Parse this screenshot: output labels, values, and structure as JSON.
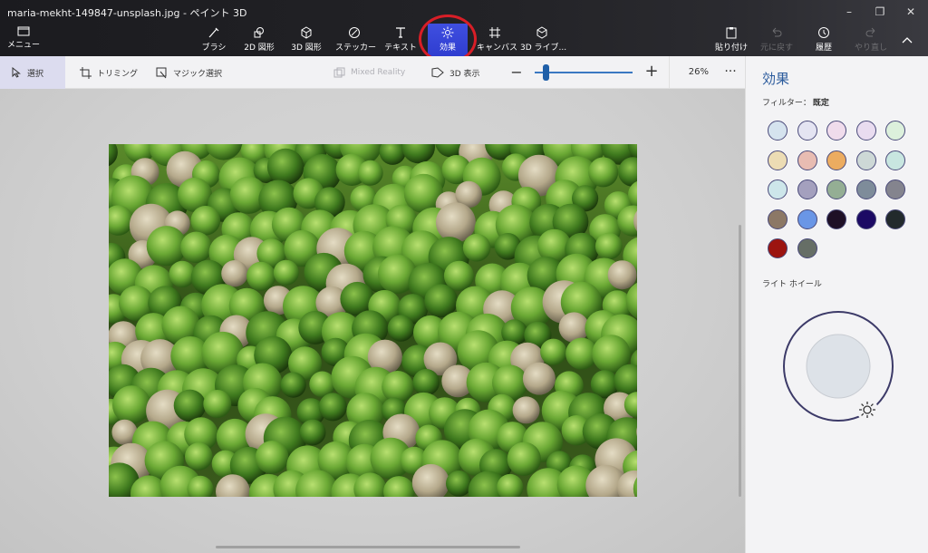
{
  "window": {
    "title": "maria-mekht-149847-unsplash.jpg - ペイント 3D",
    "controls": [
      "–",
      "❐",
      "✕"
    ]
  },
  "ribbon": {
    "menu_label": "メニュー",
    "tools": [
      {
        "id": "brush",
        "label": "ブラシ",
        "icon": "brush-icon"
      },
      {
        "id": "shapes2d",
        "label": "2D 図形",
        "icon": "shapes-2d-icon"
      },
      {
        "id": "shapes3d",
        "label": "3D 図形",
        "icon": "cube-icon"
      },
      {
        "id": "stickers",
        "label": "ステッカー",
        "icon": "sticker-icon"
      },
      {
        "id": "text",
        "label": "テキスト",
        "icon": "text-icon"
      },
      {
        "id": "effects",
        "label": "効果",
        "icon": "sun-icon",
        "active": true
      },
      {
        "id": "canvas",
        "label": "キャンバス",
        "icon": "canvas-icon"
      },
      {
        "id": "library3d",
        "label": "3D ライブ...",
        "icon": "library-3d-icon"
      }
    ],
    "right_tools": [
      {
        "id": "paste",
        "label": "貼り付け",
        "icon": "paste-icon",
        "enabled": true
      },
      {
        "id": "undo",
        "label": "元に戻す",
        "icon": "undo-icon",
        "enabled": false
      },
      {
        "id": "history",
        "label": "履歴",
        "icon": "history-icon",
        "enabled": true
      },
      {
        "id": "redo",
        "label": "やり直し",
        "icon": "redo-icon",
        "enabled": false
      }
    ],
    "collapse_icon": "chevron-up-icon"
  },
  "command_bar": {
    "select_label": "選択",
    "crop_label": "トリミング",
    "magic_select_label": "マジック選択",
    "mixed_reality_label": "Mixed Reality",
    "view3d_label": "3D 表示",
    "zoom_minus": "−",
    "zoom_plus": "+",
    "zoom_value": "26%",
    "zoom_fraction": 0.26,
    "more": "···"
  },
  "panel": {
    "title": "効果",
    "filter_label": "フィルター：",
    "filter_value": "既定",
    "swatches": [
      "#d5e3ee",
      "#e4e4f2",
      "#f0dcec",
      "#e9dcf0",
      "#dcf0dc",
      "#ecdcb4",
      "#e8bcb2",
      "#ecac60",
      "#cdd8d6",
      "#c8e6e0",
      "#cde6ea",
      "#a4a0be",
      "#94ae94",
      "#7e8c9a",
      "#84848e",
      "#8c7866",
      "#6a96e6",
      "#1e1026",
      "#1c0a64",
      "#222a2c",
      "#9c1410",
      "#666e66"
    ],
    "lightwheel_label": "ライト ホイール"
  }
}
